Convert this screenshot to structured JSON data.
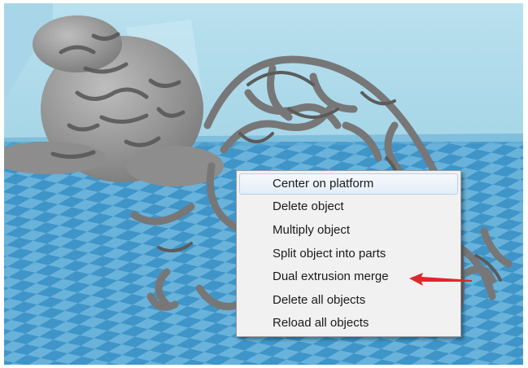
{
  "context_menu": {
    "items": [
      {
        "label": "Center on platform",
        "highlighted": true
      },
      {
        "label": "Delete object"
      },
      {
        "label": "Multiply object"
      },
      {
        "label": "Split object into parts"
      },
      {
        "label": "Dual extrusion merge",
        "annotated": true
      },
      {
        "label": "Delete all objects"
      },
      {
        "label": "Reload all objects"
      }
    ]
  },
  "colors": {
    "background_wall": "#8ecbe0",
    "platform_tile_dark": "#3f95c8",
    "platform_tile_light": "#69b2da",
    "model_gray": "#8f8f8f",
    "annotation_arrow": "#e0262b"
  },
  "icons": {
    "annotation": "red-arrow-icon"
  }
}
